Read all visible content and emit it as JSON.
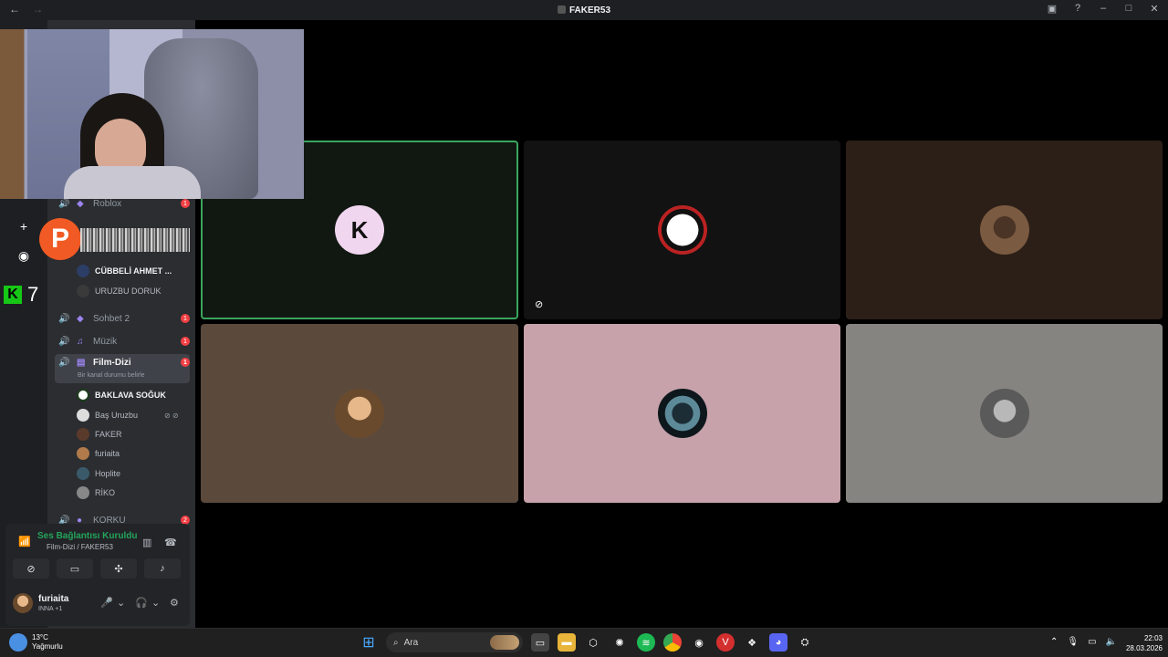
{
  "window": {
    "title": "FAKER53",
    "nav_back": "←",
    "nav_fwd": "→"
  },
  "guild_sidebar": {
    "k7_number": "7"
  },
  "channels": [
    {
      "name": "Roblox",
      "badge": "1"
    },
    {
      "name": "Sohbet 2",
      "badge": "1"
    },
    {
      "name": "Müzik",
      "badge": "1"
    },
    {
      "name": "Film-Dizi",
      "badge": "1",
      "status": "Bir kanal durumu belirle"
    },
    {
      "name": "KORKU",
      "badge": "2"
    }
  ],
  "upper_members": [
    {
      "name": "CÜBBELİ AHMET ..."
    },
    {
      "name": "URUZBU DORUK"
    }
  ],
  "film_members": [
    {
      "name": "BAKLAVA SOĞUK"
    },
    {
      "name": "Baş Uruzbu"
    },
    {
      "name": "FAKER"
    },
    {
      "name": "furiaita"
    },
    {
      "name": "Hoplite"
    },
    {
      "name": "RİKO"
    }
  ],
  "voice_panel": {
    "status": "Ses Bağlantısı Kuruldu",
    "location": "Film-Dizi / FAKER53"
  },
  "user": {
    "name": "furiaita",
    "activity": "INNA +1"
  },
  "overlay": {
    "p_badge": "P"
  },
  "taskbar": {
    "temp": "13°C",
    "weather": "Yağmurlu",
    "search_placeholder": "Ara",
    "time": "22:03",
    "date": "28.03.2026"
  }
}
